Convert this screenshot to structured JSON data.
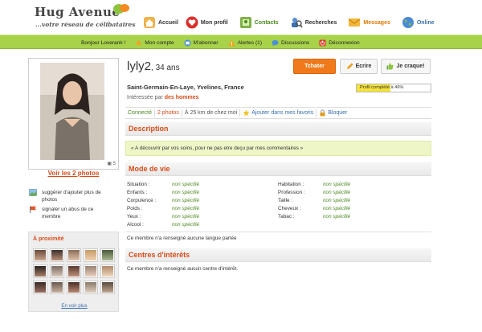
{
  "header": {
    "logo": "Hug Avenue",
    "tagline": "...votre réseau de célibataires",
    "nav": [
      {
        "label": "Accueil",
        "icon": "home-icon"
      },
      {
        "label": "Mon profil",
        "icon": "heart-icon"
      },
      {
        "label": "Contacts",
        "icon": "contacts-icon"
      },
      {
        "label": "Recherches",
        "icon": "search-people-icon"
      },
      {
        "label": "Messages",
        "icon": "envelope-icon"
      },
      {
        "label": "Online",
        "icon": "globe-icon"
      }
    ]
  },
  "subbar": {
    "greeting": "Bonjour Loverank !",
    "items": [
      {
        "label": "Mon compte",
        "icon": "star-icon"
      },
      {
        "label": "M'abonner",
        "icon": "subscribe-icon"
      },
      {
        "label": "Alertes (1)",
        "icon": "alert-icon"
      },
      {
        "label": "Discussions",
        "icon": "chat-icon"
      },
      {
        "label": "Déconnexion",
        "icon": "logout-icon"
      }
    ]
  },
  "profile": {
    "name": "lyly2",
    "age": ", 34 ans",
    "city": "Saint-Germain-En-Laye, Yvelines, France",
    "interest_prefix": "Intéressée par ",
    "interest_value": "des hommes",
    "completion_label": "Profil complété à 46%",
    "completion": 0.46,
    "photo_count": "5"
  },
  "actions": {
    "chat": "Tchater",
    "write": "Ecrire",
    "crush": "Je craque!"
  },
  "infobar": {
    "status": "Connecté",
    "photos": "2 photos",
    "distance": "À 25 km de chez moi",
    "favorite": "Ajouter dans mes favoris",
    "block": "Bloquer"
  },
  "sidebar": {
    "see_photos": "Voir les 2 photos",
    "suggest": "suggérer d'ajouter plus de photos",
    "report": "signaler un abus de ce membre",
    "nearby_title": "À proximité",
    "see_more": "En voir plus"
  },
  "description": {
    "title": "Description",
    "text": "« A découvrir par vos soins, pour ne pas etre deçu par mes commentaires »"
  },
  "lifestyle": {
    "title": "Mode de vie",
    "left": [
      {
        "key": "Situation :",
        "value": "non spécifié"
      },
      {
        "key": "Enfants :",
        "value": "non spécifié"
      },
      {
        "key": "Corpulence :",
        "value": "non spécifié"
      },
      {
        "key": "Poids :",
        "value": "non spécifié"
      },
      {
        "key": "Yeux :",
        "value": "non spécifié"
      },
      {
        "key": "Alcool :",
        "value": "non spécifié"
      }
    ],
    "right": [
      {
        "key": "Habitation :",
        "value": "non spécifié"
      },
      {
        "key": "Profession :",
        "value": "non spécifié"
      },
      {
        "key": "Taille :",
        "value": "non spécifié"
      },
      {
        "key": "Cheveux :",
        "value": "non spécifié"
      },
      {
        "key": "Tabac :",
        "value": "non spécifié"
      }
    ],
    "language_note": "Ce membre n'a renseigné aucune langue parlée"
  },
  "interests": {
    "title": "Centres d'intérêts",
    "note": "Ce membre n'a renseigné aucun centre d'intérêt."
  }
}
